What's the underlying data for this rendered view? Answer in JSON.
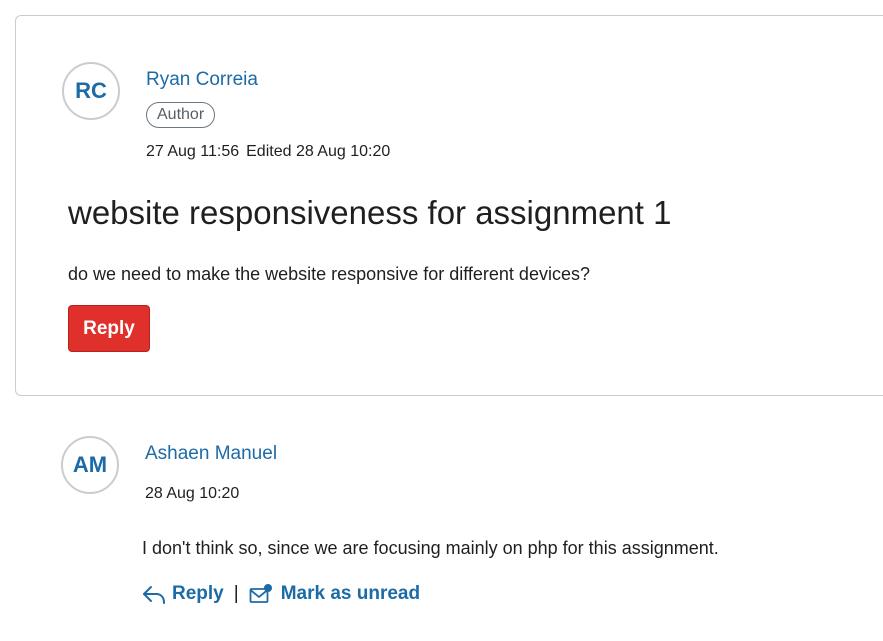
{
  "topic": {
    "author": {
      "initials": "RC",
      "name": "Ryan Correia",
      "role": "Author"
    },
    "posted": "27 Aug 11:56",
    "edited": "Edited 28 Aug 10:20",
    "title": "website responsiveness for assignment 1",
    "body": "do we need to make the website responsive for different devices?",
    "reply_label": "Reply"
  },
  "reply": {
    "author": {
      "initials": "AM",
      "name": "Ashaen Manuel"
    },
    "posted": "28 Aug 10:20",
    "body": "I don't think so, since we are focusing mainly on php for this assignment.",
    "actions": {
      "reply_label": "Reply",
      "separator": "|",
      "mark_unread_label": "Mark as unread"
    }
  },
  "colors": {
    "link": "#1c6ba6",
    "primary_button": "#e0302b",
    "border": "#c7cdd1"
  },
  "icons": {
    "reply": "reply-arrow-icon",
    "mark_unread": "envelope-unread-icon"
  }
}
